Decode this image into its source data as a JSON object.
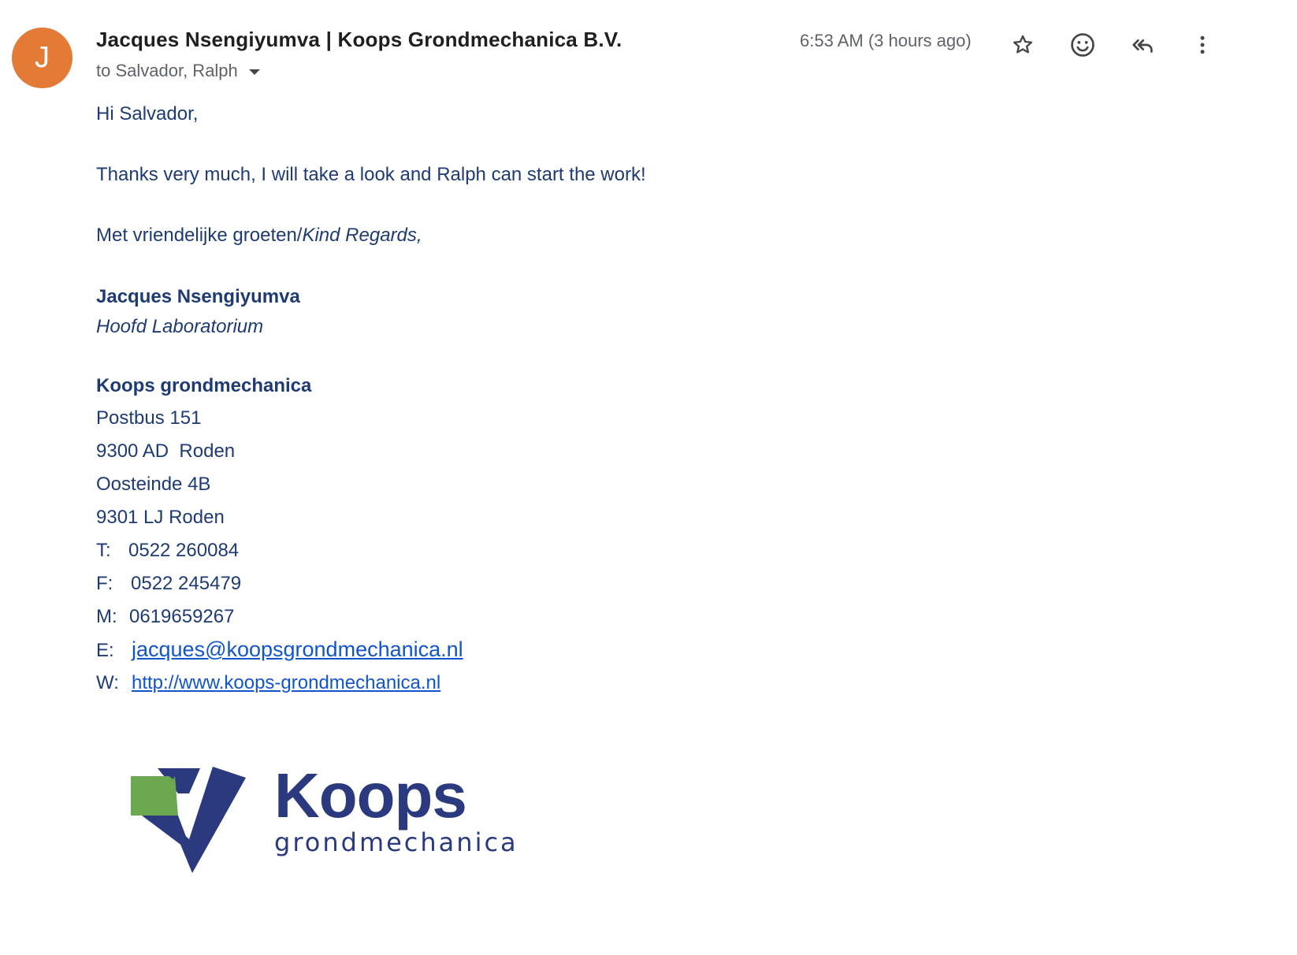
{
  "header": {
    "avatar_letter": "J",
    "avatar_color": "#e37a35",
    "sender": "Jacques Nsengiyumva | Koops Grondmechanica B.V.",
    "recipients": "to Salvador, Ralph",
    "timestamp": "6:53 AM (3 hours ago)",
    "actions": [
      {
        "name": "star",
        "icon": "star-icon"
      },
      {
        "name": "react",
        "icon": "emoji-icon"
      },
      {
        "name": "reply-all",
        "icon": "reply-all-icon"
      },
      {
        "name": "more",
        "icon": "more-vert-icon"
      }
    ]
  },
  "body": {
    "greeting": "Hi Salvador,",
    "message": "Thanks very much, I will take a look and Ralph can start the work!",
    "closing_dutch": "Met vriendelijke groeten/",
    "closing_english": "Kind Regards,"
  },
  "signature": {
    "name": "Jacques Nsengiyumva",
    "title": "Hoofd Laboratorium",
    "company": "Koops grondmechanica",
    "address": [
      "Postbus 151",
      "9300 AD  Roden",
      "Oosteinde 4B",
      "9301 LJ Roden"
    ],
    "phone_label": "T:",
    "phone": "0522 260084",
    "fax_label": "F:",
    "fax": "0522 245479",
    "mobile_label": "M:",
    "mobile": "0619659267",
    "email_label": "E:",
    "email": "jacques@koopsgrondmechanica.nl",
    "web_label": "W:",
    "web": "http://www.koops-grondmechanica.nl"
  },
  "logo": {
    "word": "Koops",
    "sub": "grondmechanica",
    "colors": {
      "primary": "#2b3a7e",
      "accent": "#6ba84f"
    }
  },
  "colors": {
    "body_text": "#1f3b73",
    "link": "#1155cc",
    "meta_text": "#5f6368"
  }
}
